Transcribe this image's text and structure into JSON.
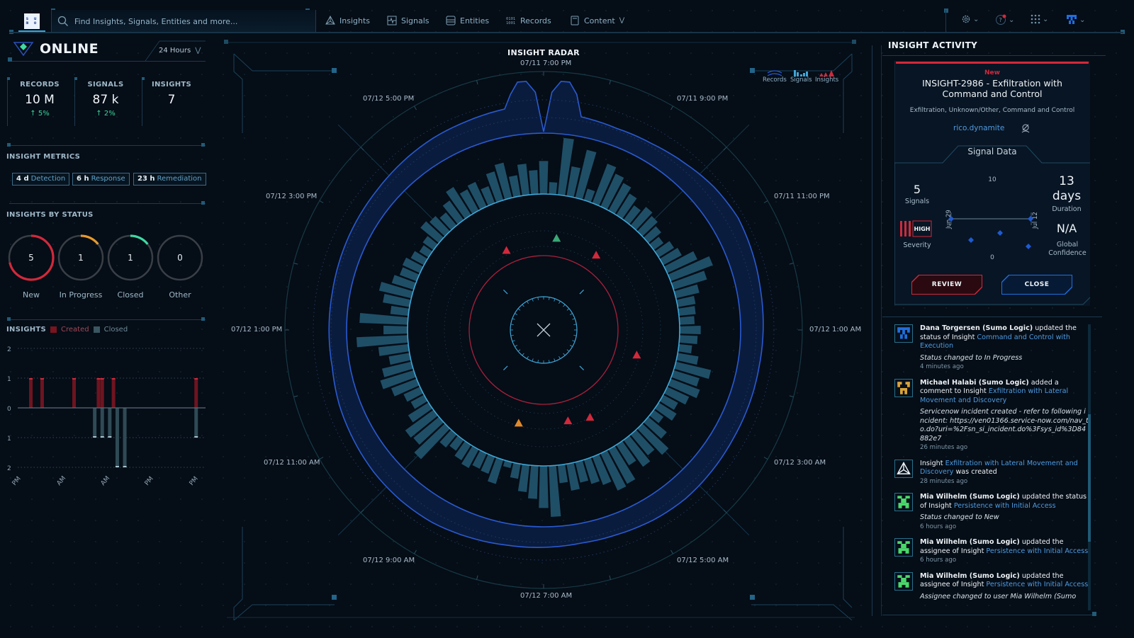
{
  "header": {
    "logo_lines": [
      "s u",
      "m o"
    ],
    "search_placeholder": "Find Insights, Signals, Entities and more...",
    "nav": [
      {
        "label": "Insights",
        "icon": "triangle-network-icon"
      },
      {
        "label": "Signals",
        "icon": "signal-waveform-icon"
      },
      {
        "label": "Entities",
        "icon": "stack-icon"
      },
      {
        "label": "Records",
        "icon": "binary-icon"
      },
      {
        "label": "Content",
        "icon": "book-icon"
      }
    ],
    "right_icons": [
      "gear-icon",
      "help-icon",
      "apps-grid-icon",
      "user-avatar-icon"
    ]
  },
  "status": {
    "label": "ONLINE",
    "time_range": "24 Hours"
  },
  "stats": [
    {
      "label": "RECORDS",
      "value": "10 M",
      "change": "5%"
    },
    {
      "label": "SIGNALS",
      "value": "87 k",
      "change": "2%"
    },
    {
      "label": "INSIGHTS",
      "value": "7",
      "change": ""
    }
  ],
  "metrics": {
    "title": "INSIGHT METRICS",
    "items": [
      {
        "value": "4 d",
        "label": "Detection"
      },
      {
        "value": "6 h",
        "label": "Response"
      },
      {
        "value": "23 h",
        "label": "Remediation"
      }
    ]
  },
  "by_status": {
    "title": "INSIGHTS BY STATUS",
    "total": 7,
    "items": [
      {
        "label": "New",
        "count": "5",
        "fraction": 0.714,
        "color": "#d1293b"
      },
      {
        "label": "In Progress",
        "count": "1",
        "fraction": 0.143,
        "color": "#e89a2c"
      },
      {
        "label": "Closed",
        "count": "1",
        "fraction": 0.143,
        "color": "#3fd9a2"
      },
      {
        "label": "Other",
        "count": "0",
        "fraction": 0,
        "color": "#4a4f55"
      }
    ]
  },
  "insights_chart": {
    "title": "INSIGHTS",
    "legend": [
      {
        "label": "Created",
        "color": "#7a1420"
      },
      {
        "label": "Closed",
        "color": "#3a5660"
      }
    ],
    "y_ticks": [
      "2",
      "1",
      "0",
      "1",
      "2"
    ],
    "x_ticks": [
      "PM",
      "AM",
      "AM",
      "PM",
      "PM"
    ]
  },
  "chart_data": [
    {
      "type": "bar",
      "title": "INSIGHTS",
      "series": [
        {
          "name": "Created",
          "x": [
            0.07,
            0.13,
            0.3,
            0.43,
            0.45,
            0.51,
            0.95
          ],
          "values": [
            1,
            1,
            1,
            1,
            1,
            1,
            1
          ]
        },
        {
          "name": "Closed",
          "x": [
            0.41,
            0.45,
            0.49,
            0.53,
            0.57,
            0.95
          ],
          "values": [
            -1,
            -1,
            -1,
            -2,
            -2,
            -1
          ]
        }
      ],
      "ylim": [
        -2,
        2
      ],
      "y_ticks": [
        "2",
        "1",
        "0",
        "1",
        "2"
      ],
      "x_ticks": [
        "PM",
        "AM",
        "AM",
        "PM",
        "PM"
      ],
      "grid": true
    },
    {
      "type": "radar",
      "title": "INSIGHT RADAR",
      "legend": [
        "Records",
        "Signals",
        "Insights"
      ],
      "time_labels": [
        "07/11 7:00 PM",
        "07/11 9:00 PM",
        "07/11 11:00 PM",
        "07/12 1:00 AM",
        "07/12 3:00 AM",
        "07/12 5:00 AM",
        "07/12 7:00 AM",
        "07/12 9:00 AM",
        "07/12 11:00 AM",
        "07/12 1:00 PM",
        "07/12 3:00 PM",
        "07/12 5:00 PM"
      ],
      "signals_bars": [
        55,
        20,
        95,
        50,
        82,
        20,
        70,
        60,
        52,
        42,
        30,
        40,
        35,
        28,
        20,
        30,
        35,
        55,
        75,
        58,
        40,
        30,
        28,
        25,
        35,
        30,
        22,
        35,
        60,
        45,
        52,
        40,
        28,
        35,
        20,
        40,
        60,
        45,
        55,
        40,
        65,
        68,
        50,
        42,
        35,
        45,
        30,
        85,
        70,
        55,
        45,
        25,
        10,
        42,
        30,
        28,
        35,
        30,
        22,
        28,
        70,
        55,
        58,
        40,
        25,
        30,
        45,
        58,
        50,
        35,
        50,
        85,
        40,
        80,
        30,
        45,
        55,
        38,
        30,
        32,
        25,
        18,
        22,
        40,
        35,
        28,
        40,
        55,
        40,
        45,
        30,
        50,
        60,
        35,
        52,
        40
      ],
      "records_outer_variation": [
        0.12,
        0.04,
        0.02,
        0.03,
        0.06,
        0.1,
        0.12,
        0.1,
        0.08,
        0.07,
        0.06,
        0.06,
        0.06,
        0.07,
        0.08,
        0.07,
        0.05,
        0.04,
        0.05,
        0.06,
        0.08,
        0.1,
        0.1,
        0.09,
        0.07,
        0.05,
        0.02,
        0.02,
        0.02,
        0.03,
        0.04,
        0.05,
        0.07,
        0.09,
        0.1,
        0.12
      ],
      "insights": [
        {
          "angle": -25,
          "radius": 0.73,
          "color": "#d1293b"
        },
        {
          "angle": 8,
          "radius": 0.77,
          "color": "#3aa876"
        },
        {
          "angle": 35,
          "radius": 0.76,
          "color": "#d1293b"
        },
        {
          "angle": 105,
          "radius": 0.8,
          "color": "#d1293b"
        },
        {
          "angle": 152,
          "radius": 0.82,
          "color": "#d1293b"
        },
        {
          "angle": 165,
          "radius": 0.78,
          "color": "#d1293b"
        },
        {
          "angle": 195,
          "radius": 0.8,
          "color": "#e08a2a"
        }
      ]
    }
  ],
  "activity": {
    "title": "INSIGHT ACTIVITY",
    "insight": {
      "status": "New",
      "title": "INSIGHT-2986 - Exfiltration with Command and Control",
      "tactics": "Exfiltration, Unknown/Other, Command and Control",
      "entity": "rico.dynamite",
      "signal_data_title": "Signal Data",
      "signals_count": "5",
      "signals_label": "Signals",
      "severity_badge": "HIGH",
      "severity_label": "Severity",
      "duration_value": "13",
      "duration_unit": "days",
      "duration_label": "Duration",
      "confidence_value": "N/A",
      "confidence_label": "Global Confidence",
      "axis_top": "10",
      "axis_bottom": "0",
      "date_start": "Jun 29",
      "date_end": "Jul 12",
      "review_label": "REVIEW",
      "close_label": "CLOSE"
    },
    "feed": [
      {
        "avatar": "blue",
        "who": "Dana Torgersen (Sumo Logic)",
        "action": " updated the status of Insight ",
        "link": "Command and Control with Execution",
        "suffix": "",
        "note": "Status changed to In Progress",
        "time": "4 minutes ago"
      },
      {
        "avatar": "orange",
        "who": "Michael Halabi (Sumo Logic)",
        "action": " added a comment to Insight ",
        "link": "Exfiltration with Lateral Movement and Discovery",
        "suffix": "",
        "note": "Servicenow incident created - refer to following incident: https://ven01366.service-now.com/nav_to.do?uri=%2Fsn_si_incident.do%3Fsys_id%3D84882e7",
        "time": "26 minutes ago"
      },
      {
        "avatar": "system",
        "who": "",
        "action": "Insight ",
        "link": "Exfiltration with Lateral Movement and Discovery",
        "suffix": " was created",
        "note": "",
        "time": "28 minutes ago"
      },
      {
        "avatar": "green",
        "who": "Mia Wilhelm (Sumo Logic)",
        "action": " updated the status of Insight ",
        "link": "Persistence with Initial Access",
        "suffix": "",
        "note": "Status changed to New",
        "time": "6 hours ago"
      },
      {
        "avatar": "green",
        "who": "Mia Wilhelm (Sumo Logic)",
        "action": " updated the assignee of Insight ",
        "link": "Persistence with Initial Access",
        "suffix": "",
        "note": "",
        "time": "6 hours ago"
      },
      {
        "avatar": "green",
        "who": "Mia Wilhelm (Sumo Logic)",
        "action": " updated the assignee of Insight ",
        "link": "Persistence with Initial Access",
        "suffix": "",
        "note": "Assignee changed to user Mia Wilhelm (Sumo",
        "time": ""
      }
    ]
  }
}
